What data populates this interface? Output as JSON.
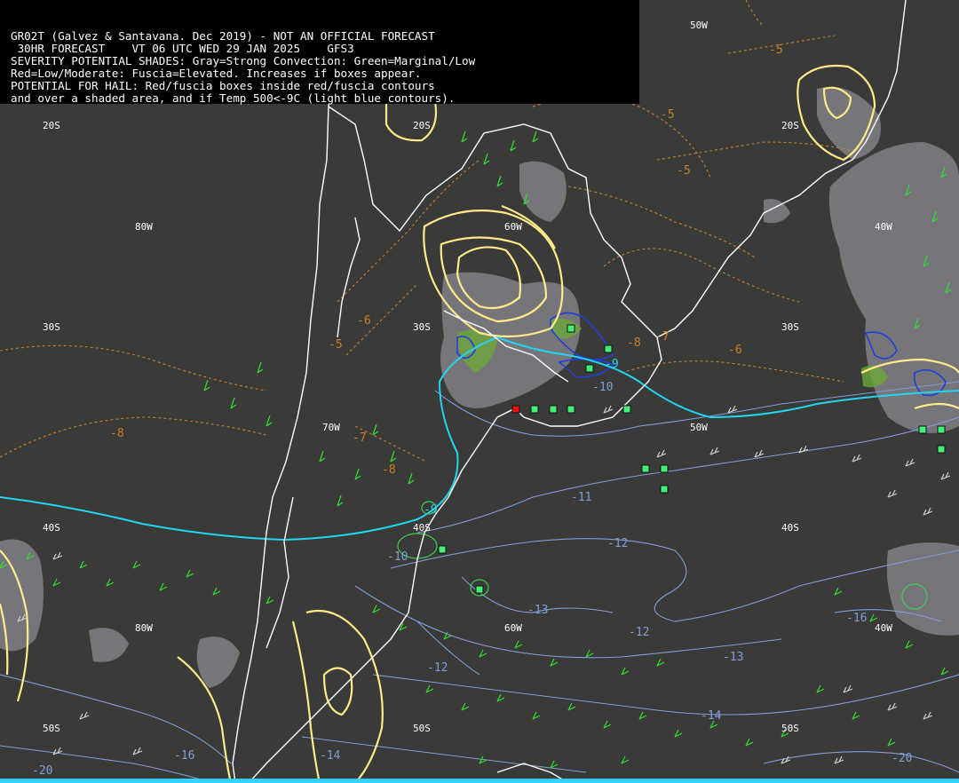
{
  "header": {
    "line1": "GR02T (Galvez & Santavana. Dec 2019) - NOT AN OFFICIAL FORECAST",
    "line2": " 30HR FORECAST    VT 06 UTC WED 29 JAN 2025    GFS3",
    "line3": "SEVERITY POTENTIAL SHADES: Gray=Strong Convection: Green=Marginal/Low",
    "line4": "Red=Low/Moderate: Fuscia=Elevated. Increases if boxes appear.",
    "line5": "POTENTIAL FOR HAIL: Red/fuscia boxes inside red/fuscia contours",
    "line6": "and over a shaded area, and if Temp 500<-9C (light blue contours)."
  },
  "grid_labels": {
    "lat_20s": "20S",
    "lat_30s": "30S",
    "lat_40s": "40S",
    "lat_50s": "50S",
    "lon_80w": "80W",
    "lon_70w": "70W",
    "lon_60w": "60W",
    "lon_50w": "50W",
    "lon_40w": "40W"
  },
  "temperature_labels": {
    "m5": "-5",
    "m6": "-6",
    "m7": "-7",
    "m8": "-8",
    "m9": "-9",
    "m10": "-10",
    "m11": "-11",
    "m12": "-12",
    "m13": "-13",
    "m14": "-14",
    "m16": "-16",
    "m20": "-20"
  },
  "colors": {
    "background": "#3a3a38",
    "coastline": "#ffffff",
    "yellow_contour": "#ffe98a",
    "orange_dashed": "#c8802a",
    "light_blue_contour": "#7f9fd8",
    "cyan_line": "#22d6f2",
    "dark_blue_contour": "#2140d8",
    "gray_shade": "#8a8a90",
    "green_shade": "#6ea63a",
    "wind_barb_green": "#33dd33",
    "wind_barb_gray": "#cfcfcf",
    "hail_box_green": "#44ee77",
    "hail_box_red": "#ee1111"
  }
}
